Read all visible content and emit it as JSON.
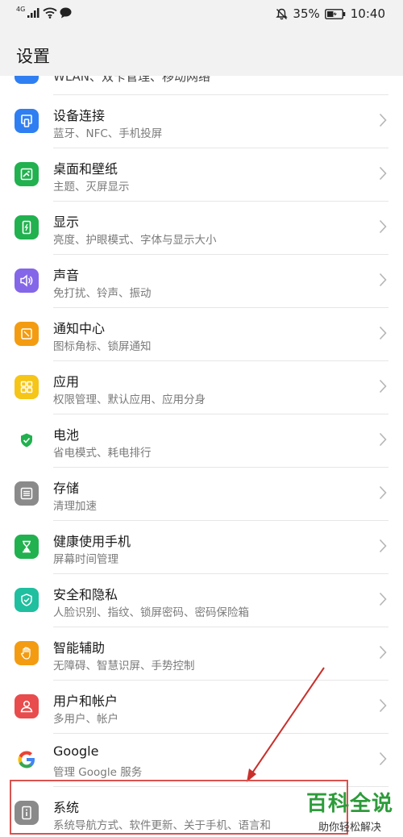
{
  "status_bar": {
    "network": "4G",
    "battery": "35%",
    "time": "10:40"
  },
  "header": {
    "title": "设置"
  },
  "list": [
    {
      "title": "WLAN、双卡管理、移动网络",
      "sub": "",
      "icon": "network-icon",
      "color": "#2f7ff2"
    },
    {
      "title": "设备连接",
      "sub": "蓝牙、NFC、手机投屏",
      "icon": "device-connect-icon",
      "color": "#2f7ff2"
    },
    {
      "title": "桌面和壁纸",
      "sub": "主题、灭屏显示",
      "icon": "wallpaper-icon",
      "color": "#21b14f"
    },
    {
      "title": "显示",
      "sub": "亮度、护眼模式、字体与显示大小",
      "icon": "display-icon",
      "color": "#21b14f"
    },
    {
      "title": "声音",
      "sub": "免打扰、铃声、振动",
      "icon": "sound-icon",
      "color": "#8466e9"
    },
    {
      "title": "通知中心",
      "sub": "图标角标、锁屏通知",
      "icon": "notification-icon",
      "color": "#f39c12"
    },
    {
      "title": "应用",
      "sub": "权限管理、默认应用、应用分身",
      "icon": "apps-icon",
      "color": "#f5c518"
    },
    {
      "title": "电池",
      "sub": "省电模式、耗电排行",
      "icon": "battery-icon",
      "color": "#21b14f"
    },
    {
      "title": "存储",
      "sub": "清理加速",
      "icon": "storage-icon",
      "color": "#8a8a8a"
    },
    {
      "title": "健康使用手机",
      "sub": "屏幕时间管理",
      "icon": "hourglass-icon",
      "color": "#21b14f"
    },
    {
      "title": "安全和隐私",
      "sub": "人脸识别、指纹、锁屏密码、密码保险箱",
      "icon": "shield-icon",
      "color": "#1fbf9f"
    },
    {
      "title": "智能辅助",
      "sub": "无障碍、智慧识屏、手势控制",
      "icon": "hand-icon",
      "color": "#f39c12"
    },
    {
      "title": "用户和帐户",
      "sub": "多用户、帐户",
      "icon": "user-icon",
      "color": "#e84c4c"
    },
    {
      "title": "Google",
      "sub": "管理 Google 服务",
      "icon": "google-icon",
      "color": "#ffffff"
    },
    {
      "title": "系统",
      "sub": "系统导航方式、软件更新、关于手机、语言和",
      "icon": "system-info-icon",
      "color": "#8a8a8a"
    }
  ],
  "watermark": {
    "line1": "百科全说",
    "line2": "助你轻松解决"
  },
  "colors": {
    "highlight": "#d9534f",
    "watermark_green": "#2d9b3a"
  }
}
